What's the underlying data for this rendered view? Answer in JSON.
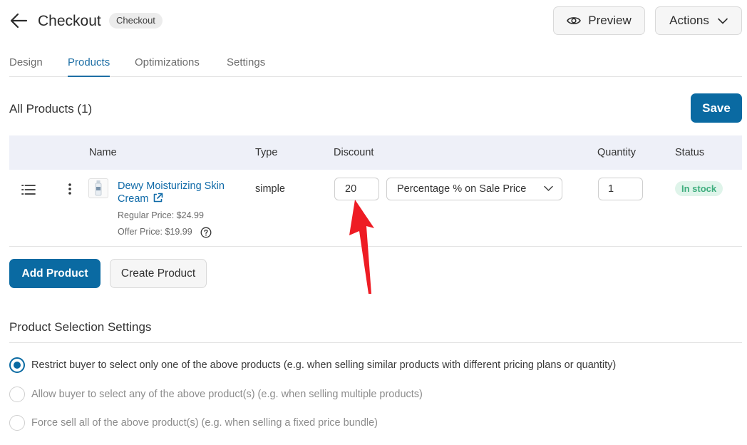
{
  "header": {
    "title": "Checkout",
    "badge": "Checkout",
    "preview_label": "Preview",
    "actions_label": "Actions"
  },
  "tabs": [
    {
      "label": "Design",
      "active": false
    },
    {
      "label": "Products",
      "active": true
    },
    {
      "label": "Optimizations",
      "active": false
    },
    {
      "label": "Settings",
      "active": false
    }
  ],
  "products_section": {
    "title": "All Products (1)",
    "save_label": "Save"
  },
  "table": {
    "columns": [
      "Name",
      "Type",
      "Discount",
      "Quantity",
      "Status"
    ],
    "rows": [
      {
        "name": "Dewy Moisturizing Skin Cream",
        "regular_price": "Regular Price: $24.99",
        "offer_price": "Offer Price: $19.99",
        "type": "simple",
        "discount_value": "20",
        "discount_type": "Percentage % on Sale Price",
        "quantity": "1",
        "status": "In stock"
      }
    ]
  },
  "buttons": {
    "add_product": "Add Product",
    "create_product": "Create Product"
  },
  "selection_settings": {
    "title": "Product Selection Settings",
    "options": [
      {
        "label": "Restrict buyer to select only one of the above products (e.g. when selling similar products with different pricing plans or quantity)",
        "checked": true
      },
      {
        "label": "Allow buyer to select any of the above product(s) (e.g. when selling multiple products)",
        "checked": false
      },
      {
        "label": "Force sell all of the above product(s) (e.g. when selling a fixed price bundle)",
        "checked": false
      }
    ]
  },
  "colors": {
    "primary": "#0a6aa2",
    "link": "#0f6aa8",
    "in_stock_text": "#3fae7e",
    "in_stock_bg": "#dff4ea",
    "annotation_arrow": "#ee1c24"
  },
  "icons": {
    "back": "arrow-left-icon",
    "preview": "eye-icon",
    "actions": "chevron-down-icon",
    "drag": "drag-handle-icon",
    "more": "kebab-menu-icon",
    "external": "external-link-icon",
    "help": "question-circle-icon"
  }
}
